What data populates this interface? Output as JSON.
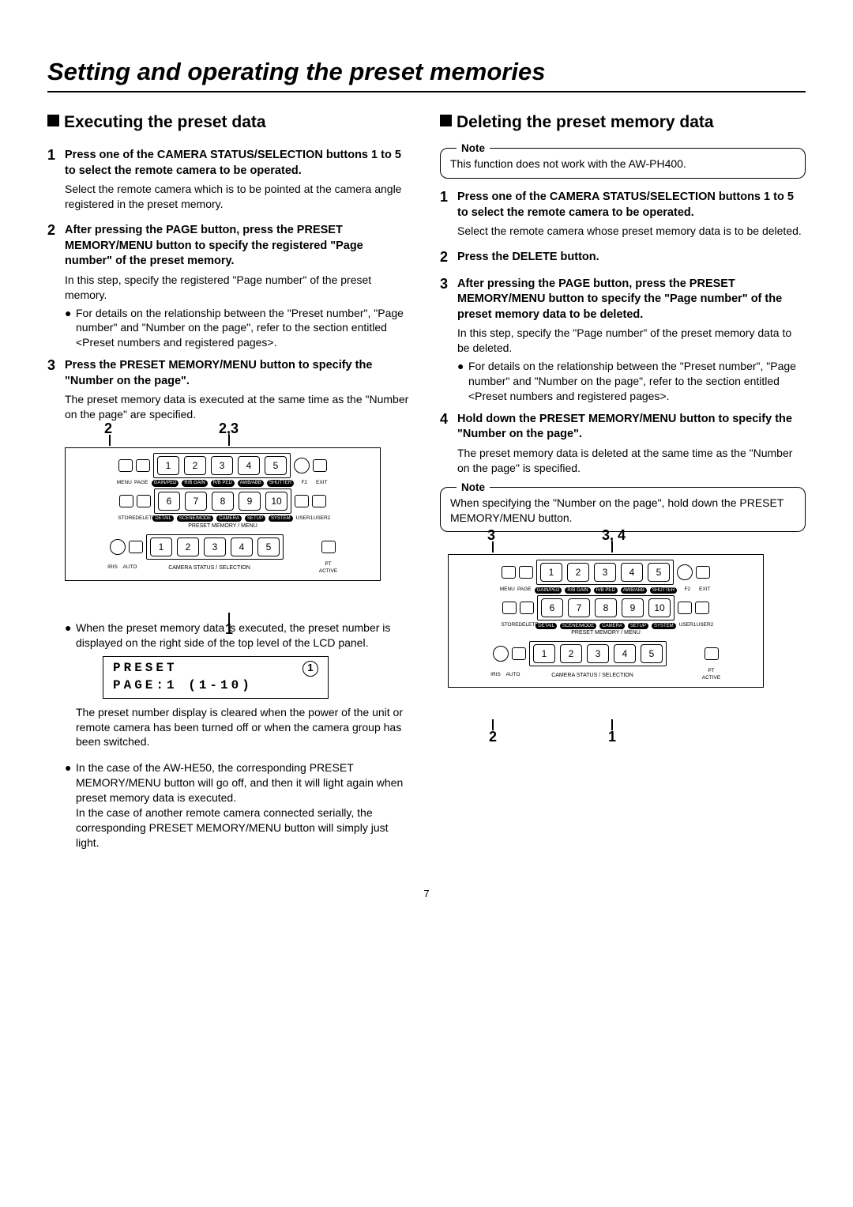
{
  "title": "Setting and operating the preset memories",
  "page_number": "7",
  "left": {
    "heading": "Executing the preset data",
    "steps": [
      {
        "num": "1",
        "title": "Press one of the CAMERA STATUS/SELECTION buttons 1 to 5 to select the remote camera to be operated.",
        "desc": "Select the remote camera which is to be pointed at the camera angle registered in the preset memory."
      },
      {
        "num": "2",
        "title": "After pressing the PAGE button, press the PRESET MEMORY/MENU button to specify the registered \"Page number\" of the preset memory.",
        "desc": "In this step, specify the registered \"Page number\" of the preset memory.",
        "bullet": "For details on the relationship between the \"Preset number\", \"Page number\" and \"Number on the page\", refer to the section entitled <Preset numbers and registered pages>."
      },
      {
        "num": "3",
        "title": "Press the PRESET MEMORY/MENU button to specify the \"Number on the page\".",
        "desc": "The preset memory data is executed at the same time as the \"Number on the page\" are specified."
      }
    ],
    "diagram_labels": {
      "top_left": "2",
      "top_right": "2,3",
      "bottom": "1"
    },
    "after_bullets": [
      "When the preset memory data is executed, the preset number is displayed on the right side of the top level of the LCD panel."
    ],
    "lcd": {
      "line1_left": "PRESET",
      "line1_right": "1",
      "line2": "PAGE:1   (1-10)"
    },
    "after_lcd": "The preset number display is cleared when the power of the unit or remote camera has been turned off or when the camera group has been switched.",
    "after_bullets2": [
      "In the case of the AW-HE50, the corresponding PRESET MEMORY/MENU button will go off, and then it will light again when preset memory data is executed.\nIn the case of another remote camera connected serially, the corresponding PRESET MEMORY/MENU button will simply just light."
    ]
  },
  "right": {
    "heading": "Deleting the preset memory data",
    "note1_label": "Note",
    "note1": "This function does not work with the AW-PH400.",
    "steps": [
      {
        "num": "1",
        "title": "Press one of the CAMERA STATUS/SELECTION buttons 1 to 5 to select the remote camera to be operated.",
        "desc": "Select the remote camera whose preset memory data is to be deleted."
      },
      {
        "num": "2",
        "title": "Press the DELETE button."
      },
      {
        "num": "3",
        "title": "After pressing the PAGE button, press the PRESET MEMORY/MENU button to specify the \"Page number\" of the preset memory data to be deleted.",
        "desc": "In this step, specify the \"Page number\" of the preset memory data to be deleted.",
        "bullet": "For details on the relationship between the \"Preset number\", \"Page number\" and \"Number on the page\", refer to the section entitled <Preset numbers and registered pages>."
      },
      {
        "num": "4",
        "title": "Hold down the PRESET MEMORY/MENU button to specify the \"Number on the page\".",
        "desc": "The preset memory data is deleted at the same time as the \"Number on the page\" is specified."
      }
    ],
    "note2_label": "Note",
    "note2": "When specifying the \"Number on the page\", hold down the PRESET MEMORY/MENU button.",
    "diagram_labels": {
      "top_left": "3",
      "top_right": "3, 4",
      "bottom_left": "2",
      "bottom_right": "1"
    }
  },
  "panel": {
    "row1_labels_left": [
      "MENU",
      "PAGE"
    ],
    "row1_ovals": [
      "GAIN/PED",
      "R/B GAIN",
      "R/B PED",
      "AWB/ABB",
      "SHUTTER"
    ],
    "row1_labels_right": [
      "F2",
      "EXIT"
    ],
    "row2_labels_left": [
      "STORE",
      "DELETE"
    ],
    "row2_ovals": [
      "DETAIL",
      "SCENE/MODE",
      "CAMERA",
      "SETUP",
      "SYSTEM"
    ],
    "row2_labels_right": [
      "USER1",
      "USER2"
    ],
    "preset_caption": "PRESET MEMORY / MENU",
    "row3_labels_left": [
      "IRIS",
      "AUTO"
    ],
    "camera_caption": "CAMERA STATUS / SELECTION",
    "row3_label_right": "PT ACTIVE"
  }
}
